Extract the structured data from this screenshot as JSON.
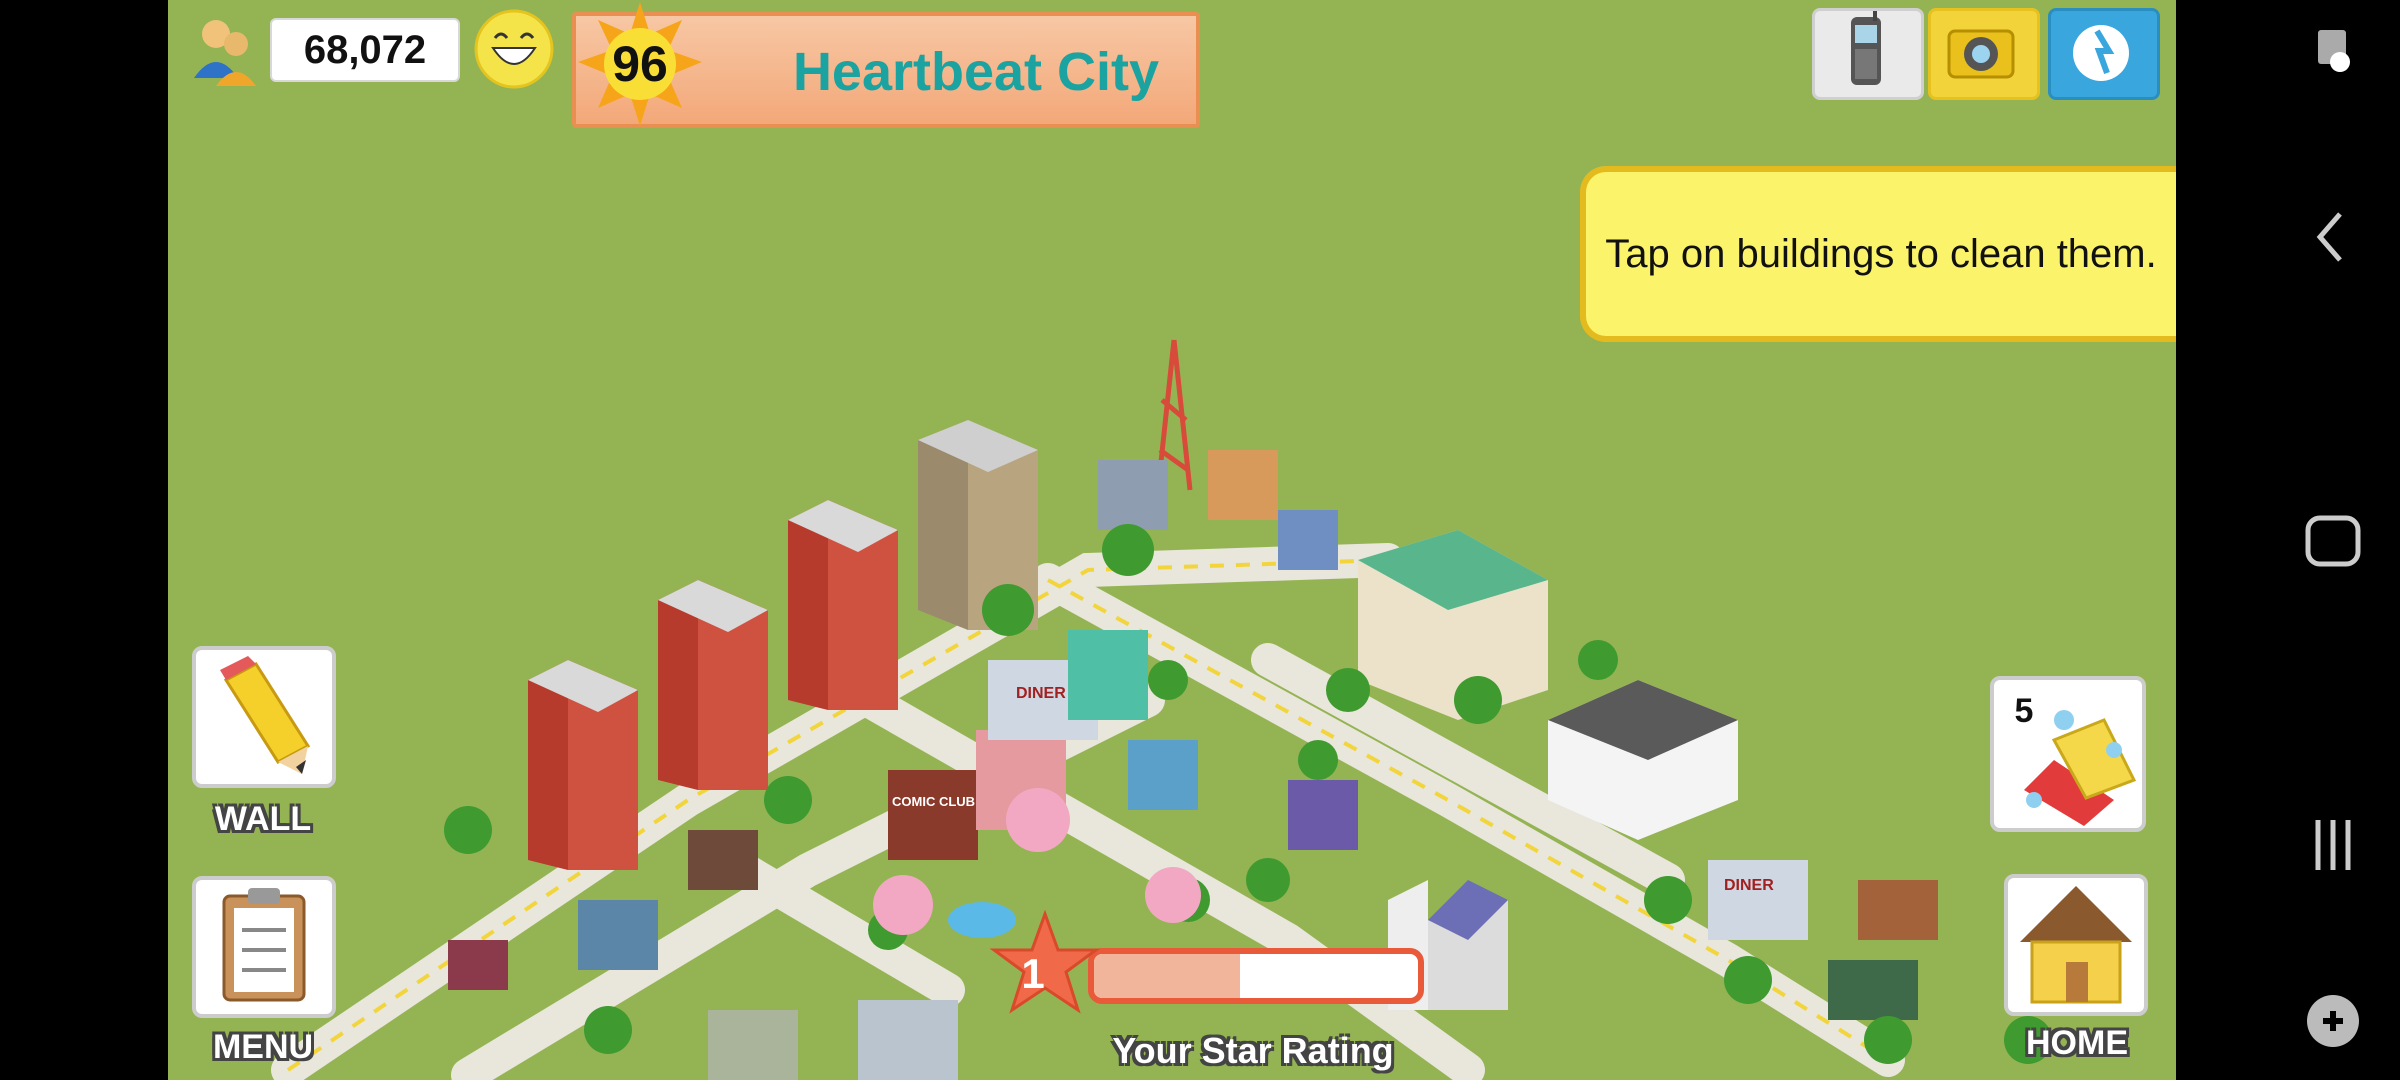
{
  "hud": {
    "population": "68,072",
    "level": "96",
    "city_name": "Heartbeat City"
  },
  "tooltip": {
    "text": "Tap on buildings to clean them."
  },
  "side_buttons": {
    "wall_label": "WALL",
    "menu_label": "MENU",
    "home_label": "HOME",
    "clean_count": "5"
  },
  "star_rating": {
    "value": "1",
    "label": "Your Star Rating",
    "progress": 0.45
  },
  "city_signs": {
    "diner_1": "DINER",
    "diner_2": "DINER",
    "comic": "COMIC CLUB"
  },
  "icons": {
    "top_right": [
      "phone-icon",
      "camera-icon",
      "social-icon"
    ],
    "nav": [
      "screenshot-icon",
      "back-icon",
      "home-nav-icon",
      "recents-icon",
      "game-tools-icon"
    ]
  },
  "colors": {
    "grass": "#94b454",
    "title_text": "#1aa3a0",
    "tooltip_bg": "#fbf36a",
    "star_red": "#e85a3a"
  }
}
